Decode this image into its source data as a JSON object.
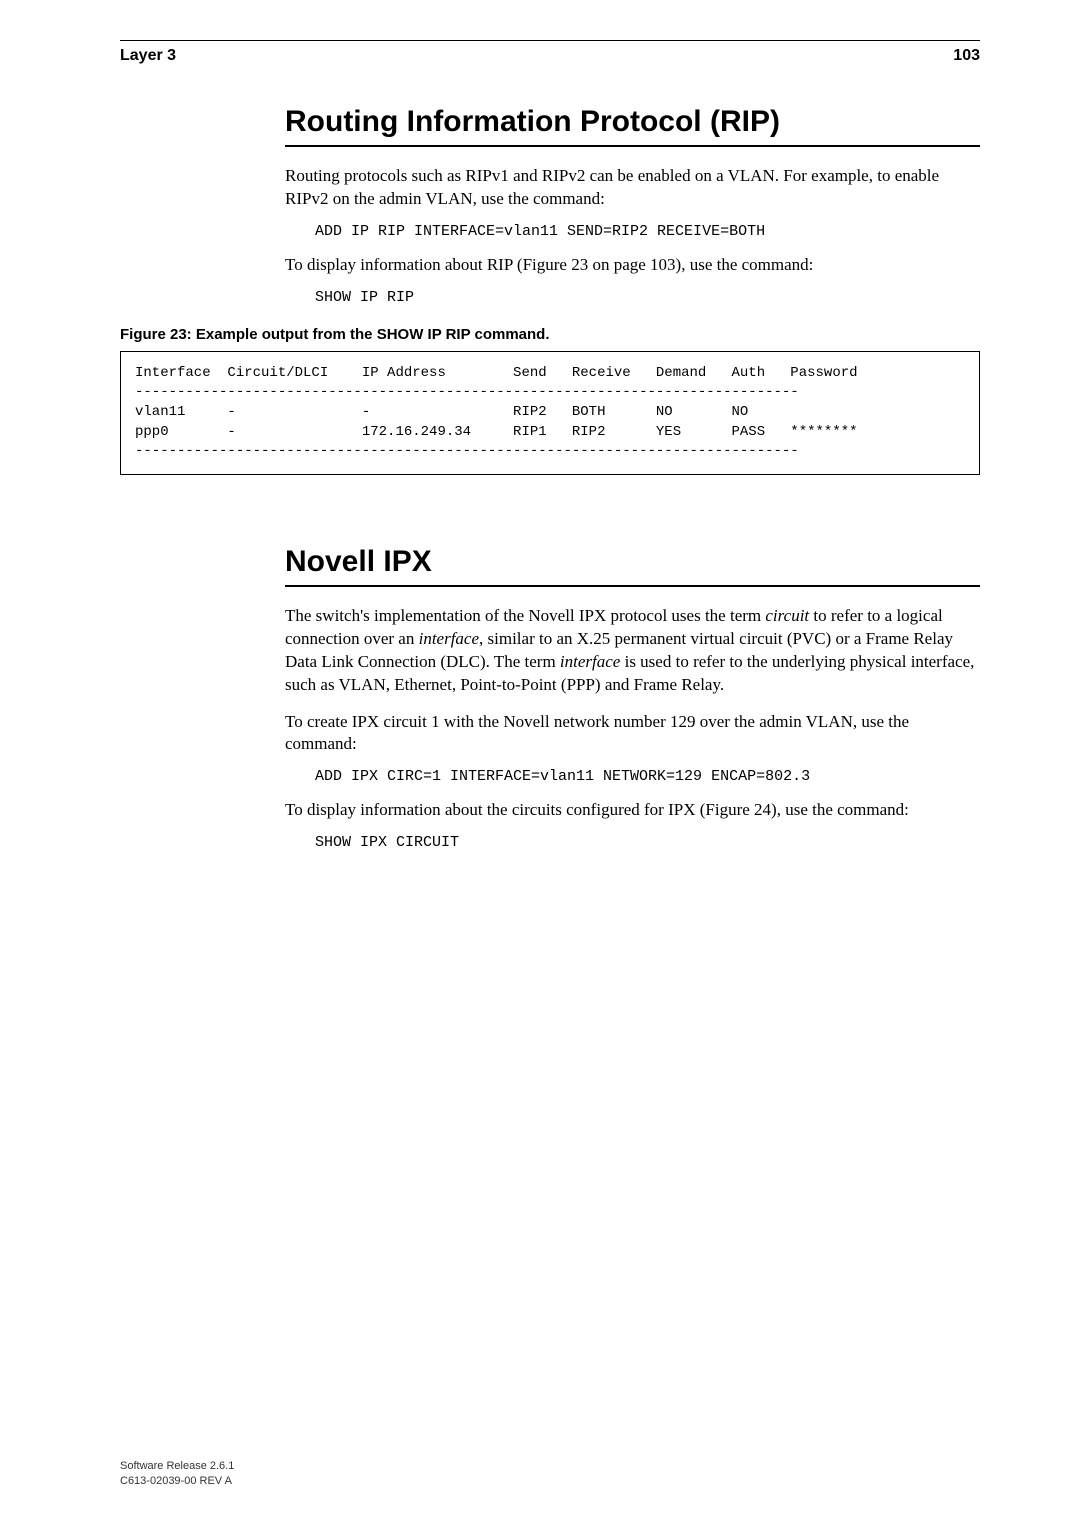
{
  "header": {
    "left": "Layer 3",
    "right": "103"
  },
  "section_rip": {
    "title": "Routing Information Protocol (RIP)",
    "p1": "Routing protocols such as RIPv1 and RIPv2 can be enabled on a VLAN. For example, to enable RIPv2 on the admin VLAN, use the command:",
    "cmd1": "ADD IP RIP INTERFACE=vlan11 SEND=RIP2 RECEIVE=BOTH",
    "p2": "To display information about RIP (Figure 23 on page 103), use the command:",
    "cmd2": "SHOW IP RIP",
    "fig_caption": "Figure 23: Example output from the SHOW IP RIP command.",
    "fig_text": "Interface  Circuit/DLCI    IP Address        Send   Receive   Demand   Auth   Password\n-------------------------------------------------------------------------------\nvlan11     -               -                 RIP2   BOTH      NO       NO\nppp0       -               172.16.249.34     RIP1   RIP2      YES      PASS   ********\n-------------------------------------------------------------------------------"
  },
  "section_ipx": {
    "title": "Novell IPX",
    "p1_a": "The switch's implementation of the Novell IPX protocol uses the term ",
    "p1_circuit": "circuit",
    "p1_b": " to refer to a logical connection over an ",
    "p1_interface": "interface",
    "p1_c": ", similar to an X.25 permanent virtual circuit (PVC) or a Frame Relay Data Link Connection (DLC). The term ",
    "p1_interface2": "interface",
    "p1_d": " is used to refer to the underlying physical interface, such as VLAN, Ethernet, Point-to-Point (PPP) and Frame Relay.",
    "p2": "To create IPX circuit 1 with the Novell network number 129 over the admin VLAN, use the command:",
    "cmd1": "ADD IPX CIRC=1 INTERFACE=vlan11 NETWORK=129 ENCAP=802.3",
    "p3": "To display information about the circuits configured for IPX (Figure 24), use the command:",
    "cmd2": "SHOW IPX CIRCUIT"
  },
  "footer": {
    "line1": "Software Release 2.6.1",
    "line2": "C613-02039-00 REV A"
  }
}
